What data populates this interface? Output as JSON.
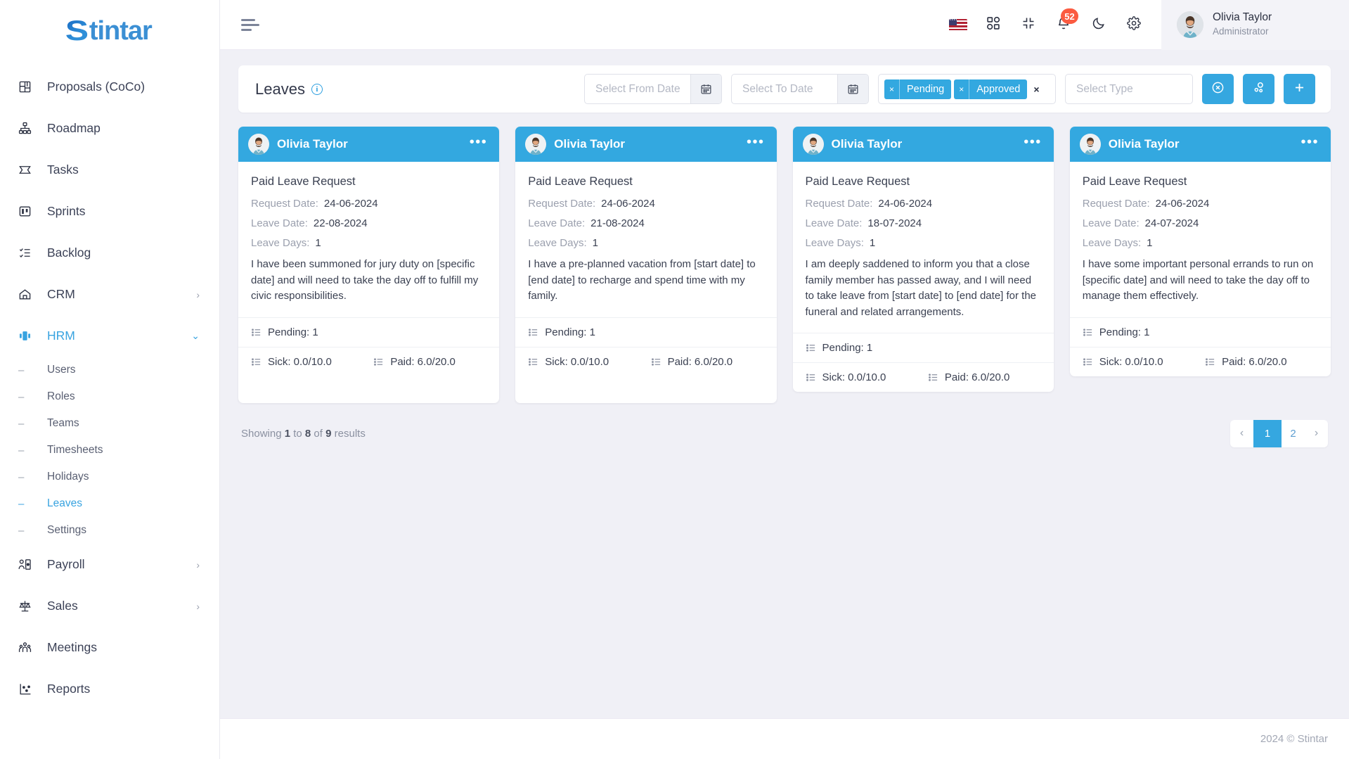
{
  "brand": {
    "prefix": "S",
    "rest": "tintar"
  },
  "sidebar": {
    "items": [
      {
        "label": "Proposals (CoCo)",
        "icon": "proposals-icon",
        "caret": ""
      },
      {
        "label": "Roadmap",
        "icon": "roadmap-icon",
        "caret": ""
      },
      {
        "label": "Tasks",
        "icon": "tasks-icon",
        "caret": ""
      },
      {
        "label": "Sprints",
        "icon": "sprints-icon",
        "caret": ""
      },
      {
        "label": "Backlog",
        "icon": "backlog-icon",
        "caret": ""
      },
      {
        "label": "CRM",
        "icon": "crm-icon",
        "caret": "›"
      },
      {
        "label": "HRM",
        "icon": "hrm-icon",
        "caret": "⌄"
      }
    ],
    "hrm_children": [
      {
        "label": "Users"
      },
      {
        "label": "Roles"
      },
      {
        "label": "Teams"
      },
      {
        "label": "Timesheets"
      },
      {
        "label": "Holidays"
      },
      {
        "label": "Leaves"
      },
      {
        "label": "Settings"
      }
    ],
    "items_after": [
      {
        "label": "Payroll",
        "icon": "payroll-icon",
        "caret": "›"
      },
      {
        "label": "Sales",
        "icon": "sales-icon",
        "caret": "›"
      },
      {
        "label": "Meetings",
        "icon": "meetings-icon",
        "caret": ""
      },
      {
        "label": "Reports",
        "icon": "reports-icon",
        "caret": ""
      }
    ],
    "dash": "–",
    "active_item": "HRM",
    "active_child": "Leaves"
  },
  "topbar": {
    "icons": [
      {
        "name": "language-flag-us-icon"
      },
      {
        "name": "apps-grid-icon"
      },
      {
        "name": "fullscreen-collapse-icon"
      },
      {
        "name": "notifications-bell-icon",
        "badge": "52"
      },
      {
        "name": "dark-mode-moon-icon"
      },
      {
        "name": "settings-gear-icon"
      }
    ],
    "notification_count": "52",
    "user": {
      "name": "Olivia Taylor",
      "role": "Administrator"
    }
  },
  "filter": {
    "title": "Leaves",
    "info_glyph": "i",
    "from_date_placeholder": "Select From Date",
    "from_date_value": "",
    "to_date_placeholder": "Select To Date",
    "to_date_value": "",
    "tags": [
      {
        "label": "Pending"
      },
      {
        "label": "Approved"
      }
    ],
    "tag_remove_glyph": "×",
    "tags_clear_glyph": "×",
    "type_placeholder": "Select Type",
    "type_value": "",
    "buttons": [
      {
        "name": "clear-filters-button",
        "icon": "circle-x-icon"
      },
      {
        "name": "filter-options-button",
        "icon": "filter-circles-icon"
      },
      {
        "name": "add-leave-button",
        "icon": "plus-icon",
        "glyph": "+"
      }
    ],
    "accent": "#33a8e0"
  },
  "cards": [
    {
      "user": "Olivia Taylor",
      "title": "Paid Leave Request",
      "request_date_label": "Request Date:",
      "request_date": "24-06-2024",
      "leave_date_label": "Leave Date:",
      "leave_date": "22-08-2024",
      "leave_days_label": "Leave Days:",
      "leave_days": "1",
      "reason": "I have been summoned for jury duty on [specific date] and will need to take the day off to fulfill my civic responsibilities.",
      "pending": "Pending: 1",
      "sick": "Sick: 0.0/10.0",
      "paid": "Paid: 6.0/20.0",
      "menu_glyph": "•••"
    },
    {
      "user": "Olivia Taylor",
      "title": "Paid Leave Request",
      "request_date_label": "Request Date:",
      "request_date": "24-06-2024",
      "leave_date_label": "Leave Date:",
      "leave_date": "21-08-2024",
      "leave_days_label": "Leave Days:",
      "leave_days": "1",
      "reason": "I have a pre-planned vacation from [start date] to [end date] to recharge and spend time with my family.",
      "pending": "Pending: 1",
      "sick": "Sick: 0.0/10.0",
      "paid": "Paid: 6.0/20.0",
      "menu_glyph": "•••"
    },
    {
      "user": "Olivia Taylor",
      "title": "Paid Leave Request",
      "request_date_label": "Request Date:",
      "request_date": "24-06-2024",
      "leave_date_label": "Leave Date:",
      "leave_date": "18-07-2024",
      "leave_days_label": "Leave Days:",
      "leave_days": "1",
      "reason": "I am deeply saddened to inform you that a close family member has passed away, and I will need to take leave from [start date] to [end date] for the funeral and related arrangements.",
      "pending": "Pending: 1",
      "sick": "Sick: 0.0/10.0",
      "paid": "Paid: 6.0/20.0",
      "menu_glyph": "•••"
    },
    {
      "user": "Olivia Taylor",
      "title": "Paid Leave Request",
      "request_date_label": "Request Date:",
      "request_date": "24-06-2024",
      "leave_date_label": "Leave Date:",
      "leave_date": "24-07-2024",
      "leave_days_label": "Leave Days:",
      "leave_days": "1",
      "reason": "I have some important personal errands to run on [specific date] and will need to take the day off to manage them effectively.",
      "pending": "Pending: 1",
      "sick": "Sick: 0.0/10.0",
      "paid": "Paid: 6.0/20.0",
      "menu_glyph": "•••"
    }
  ],
  "pagination": {
    "showing_prefix": "Showing ",
    "from": "1",
    "mid1": " to ",
    "to": "8",
    "mid2": " of ",
    "total": "9",
    "suffix": " results",
    "prev_glyph": "‹",
    "next_glyph": "›",
    "pages": [
      "1",
      "2"
    ],
    "current": "1"
  },
  "footer": {
    "text": "2024 © Stintar"
  }
}
